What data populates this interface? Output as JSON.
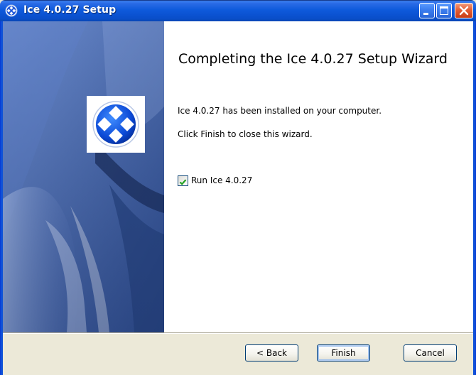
{
  "window": {
    "title": "Ice 4.0.27 Setup",
    "icon": "ice-app-icon",
    "controls": {
      "minimize_icon": "minimize-icon",
      "maximize_icon": "maximize-icon",
      "close_icon": "close-icon"
    }
  },
  "banner": {
    "logo": "ice-logo-icon"
  },
  "content": {
    "heading": "Completing the Ice 4.0.27 Setup Wizard",
    "installed_text": "Ice 4.0.27 has been installed on your computer.",
    "close_hint": "Click Finish to close this wizard.",
    "run_checkbox": {
      "label": "Run Ice 4.0.27",
      "checked": true
    }
  },
  "buttons": {
    "back_label": "< Back",
    "finish_label": "Finish",
    "cancel_label": "Cancel"
  },
  "colors": {
    "titlebar": "#0a4ec8",
    "banner": "#3f62ab",
    "dialog_bg": "#ece9d8",
    "check_green": "#21a121"
  }
}
